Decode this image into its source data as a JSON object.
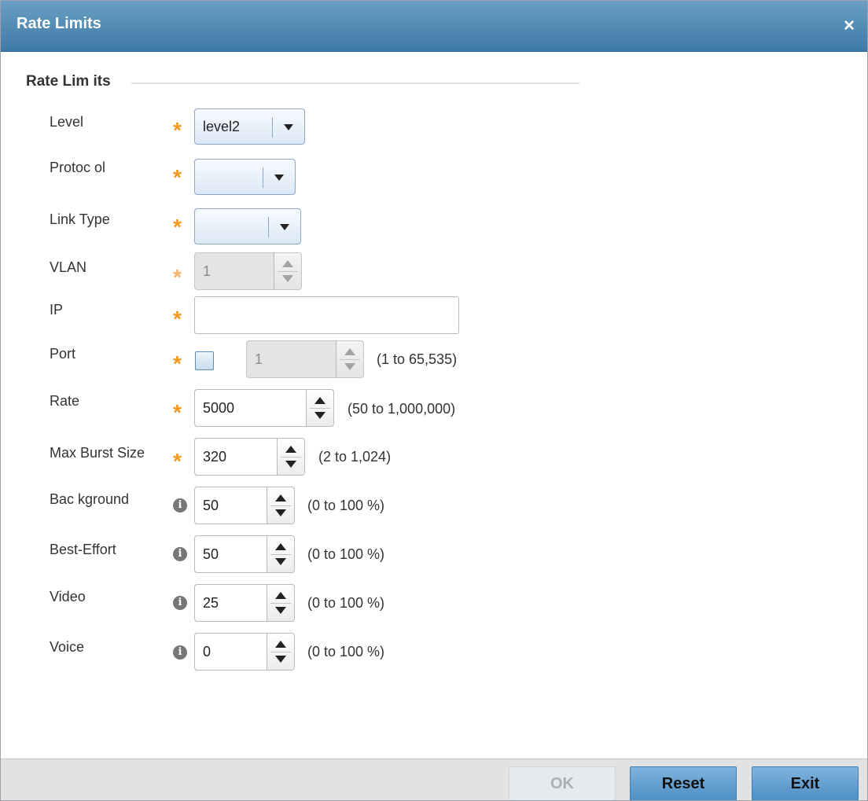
{
  "dialog": {
    "title": "Rate Limits",
    "close_glyph": "×"
  },
  "section": {
    "title": "Rate Lim its"
  },
  "fields": {
    "level": {
      "label": "Level",
      "value": "level2",
      "required": true
    },
    "protocol": {
      "label": "Protoc ol",
      "value": "",
      "required": true
    },
    "link_type": {
      "label": "Link Type",
      "value": "",
      "required": true
    },
    "vlan": {
      "label": "VLAN",
      "value": "1",
      "required": true,
      "disabled": true
    },
    "ip": {
      "label": "IP",
      "value": "",
      "required": true
    },
    "port": {
      "label": "Port",
      "checked": false,
      "value": "1",
      "range": "(1 to 65,535)",
      "required": true,
      "disabled": true
    },
    "rate": {
      "label": "Rate",
      "value": "5000",
      "range": "(50 to 1,000,000)",
      "required": true
    },
    "max_burst_size": {
      "label": "Max Burst Size",
      "value": "320",
      "range": "(2 to 1,024)",
      "required": true
    },
    "background": {
      "label": "Bac kground",
      "value": "50",
      "range": "(0 to 100 %)",
      "info": true
    },
    "best_effort": {
      "label": "Best-Effort",
      "value": "50",
      "range": "(0 to 100 %)",
      "info": true
    },
    "video": {
      "label": "Video",
      "value": "25",
      "range": "(0 to 100 %)",
      "info": true
    },
    "voice": {
      "label": "Voice",
      "value": "0",
      "range": "(0 to 100 %)",
      "info": true
    }
  },
  "icons": {
    "required": "asterisk-icon",
    "info": "info-icon",
    "close": "close-icon"
  },
  "colors": {
    "titlebar": "#4a86b4",
    "required_star": "#f39a1e",
    "primary_button": "#5b9acb"
  },
  "footer": {
    "ok_label": "OK",
    "reset_label": "Reset",
    "exit_label": "Exit"
  }
}
